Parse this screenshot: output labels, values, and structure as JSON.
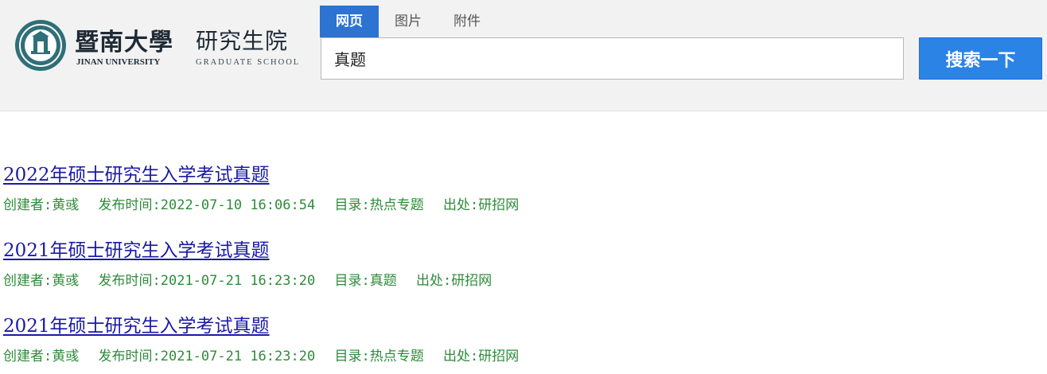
{
  "header": {
    "logo": {
      "university_cn": "暨南大學",
      "university_en": "JINAN UNIVERSITY",
      "school_cn": "研究生院",
      "school_en": "GRADUATE SCHOOL"
    },
    "tabs": [
      {
        "label": "网页",
        "active": true
      },
      {
        "label": "图片",
        "active": false
      },
      {
        "label": "附件",
        "active": false
      }
    ],
    "search": {
      "value": "真题",
      "button_label": "搜索一下"
    }
  },
  "results": [
    {
      "title": "2022年硕士研究生入学考试真题",
      "creator": "创建者:黄彧",
      "published": "发布时间:2022-07-10 16:06:54",
      "category": "目录:热点专题",
      "source": "出处:研招网"
    },
    {
      "title": "2021年硕士研究生入学考试真题",
      "creator": "创建者:黄彧",
      "published": "发布时间:2021-07-21 16:23:20",
      "category": "目录:真题",
      "source": "出处:研招网"
    },
    {
      "title": "2021年硕士研究生入学考试真题",
      "creator": "创建者:黄彧",
      "published": "发布时间:2021-07-21 16:23:20",
      "category": "目录:热点专题",
      "source": "出处:研招网"
    }
  ],
  "colors": {
    "header_bg": "#f2f2f2",
    "tab_active": "#2c73d2",
    "search_button": "#2c83e6",
    "link": "#1a1aa6",
    "meta": "#2e8b3a"
  }
}
